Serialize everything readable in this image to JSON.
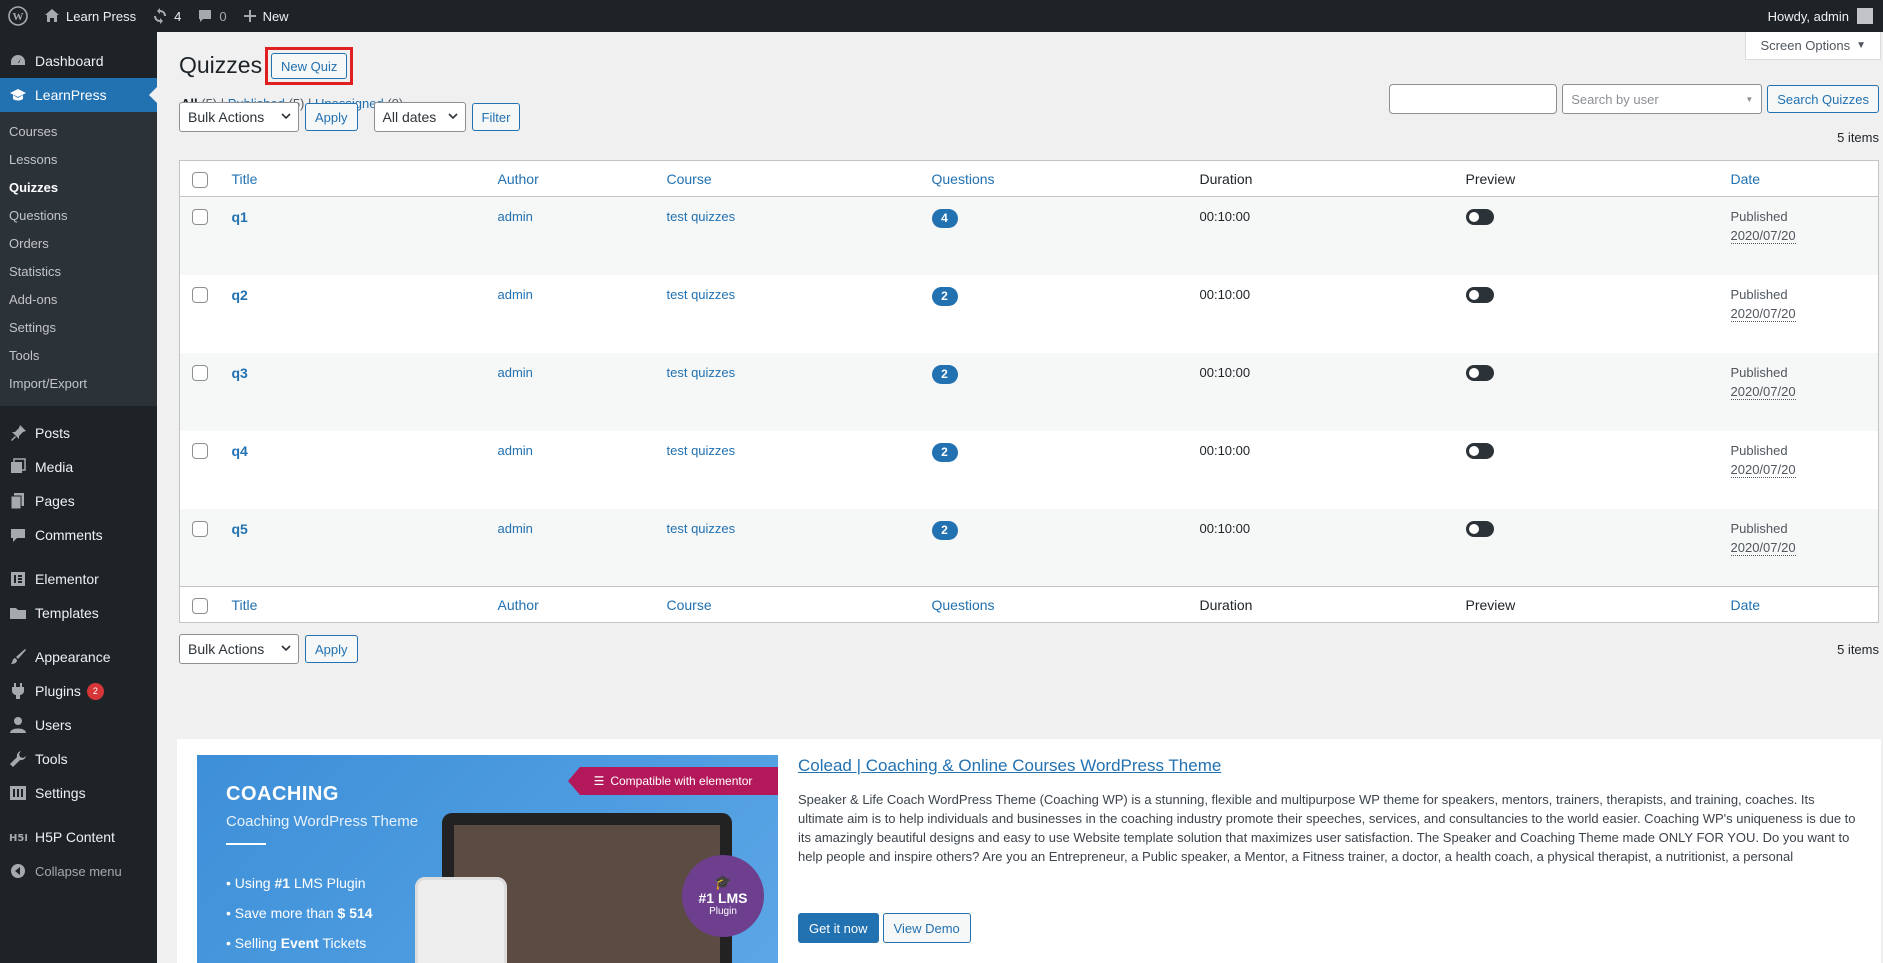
{
  "adminbar": {
    "site_name": "Learn Press",
    "updates_count": "4",
    "comments_count": "0",
    "new_label": "New",
    "howdy": "Howdy, admin"
  },
  "sidebar": {
    "dashboard": "Dashboard",
    "learnpress": "LearnPress",
    "sub": [
      "Courses",
      "Lessons",
      "Quizzes",
      "Questions",
      "Orders",
      "Statistics",
      "Add-ons",
      "Settings",
      "Tools",
      "Import/Export"
    ],
    "posts": "Posts",
    "media": "Media",
    "pages": "Pages",
    "comments": "Comments",
    "elementor": "Elementor",
    "templates": "Templates",
    "appearance": "Appearance",
    "plugins": "Plugins",
    "plugins_badge": "2",
    "users": "Users",
    "tools": "Tools",
    "settings": "Settings",
    "h5p": "H5P Content",
    "collapse": "Collapse menu"
  },
  "main": {
    "screen_options": "Screen Options",
    "title": "Quizzes",
    "new_quiz": "New Quiz",
    "filters": {
      "all": "All",
      "all_count": "(5)",
      "published": "Published",
      "published_count": "(5)",
      "unassigned": "Unassigned",
      "unassigned_count": "(0)"
    },
    "search_user_placeholder": "Search by user",
    "search_button": "Search Quizzes",
    "bulk_actions": "Bulk Actions",
    "apply": "Apply",
    "all_dates": "All dates",
    "filter": "Filter",
    "items_count": "5 items",
    "columns": [
      "Title",
      "Author",
      "Course",
      "Questions",
      "Duration",
      "Preview",
      "Date"
    ],
    "rows": [
      {
        "title": "q1",
        "author": "admin",
        "course": "test quizzes",
        "questions": "4",
        "duration": "00:10:00",
        "status": "Published",
        "date": "2020/07/20"
      },
      {
        "title": "q2",
        "author": "admin",
        "course": "test quizzes",
        "questions": "2",
        "duration": "00:10:00",
        "status": "Published",
        "date": "2020/07/20"
      },
      {
        "title": "q3",
        "author": "admin",
        "course": "test quizzes",
        "questions": "2",
        "duration": "00:10:00",
        "status": "Published",
        "date": "2020/07/20"
      },
      {
        "title": "q4",
        "author": "admin",
        "course": "test quizzes",
        "questions": "2",
        "duration": "00:10:00",
        "status": "Published",
        "date": "2020/07/20"
      },
      {
        "title": "q5",
        "author": "admin",
        "course": "test quizzes",
        "questions": "2",
        "duration": "00:10:00",
        "status": "Published",
        "date": "2020/07/20"
      }
    ]
  },
  "promo": {
    "ribbon": "Compatible with elementor",
    "coach_title": "COACHING",
    "coach_sub": "Coaching WordPress Theme",
    "bullet1_pre": "Using ",
    "bullet1_bold": "#1",
    "bullet1_post": " LMS Plugin",
    "bullet2_pre": "Save more than ",
    "bullet2_bold": "$ 514",
    "bullet3_pre": "Selling ",
    "bullet3_bold": "Event",
    "bullet3_post": " Tickets",
    "seal_main": "#1 LMS",
    "seal_sub": "Plugin",
    "title": "Colead | Coaching & Online Courses WordPress Theme",
    "description": "Speaker & Life Coach WordPress Theme (Coaching WP) is a stunning, flexible and multipurpose WP theme for speakers, mentors, trainers, therapists, and training, coaches. Its ultimate aim is to help individuals and businesses in the coaching industry promote their speeches, services, and consultancies to the world easier. Coaching WP's uniqueness is due to its amazingly beautiful designs and easy to use Website template solution that maximizes user satisfaction. The Speaker and Coaching Theme made ONLY FOR YOU. Do you want to help people and inspire others? Are you an Entrepreneur, a Public speaker, a Mentor, a Fitness trainer, a doctor, a health coach, a physical therapist, a nutritionist, a personal",
    "get_it": "Get it now",
    "view_demo": "View Demo"
  },
  "colors": {
    "accent": "#2271b1",
    "admin_dark": "#1d2327",
    "highlight_red": "#e02020",
    "badge_red": "#d63638"
  }
}
